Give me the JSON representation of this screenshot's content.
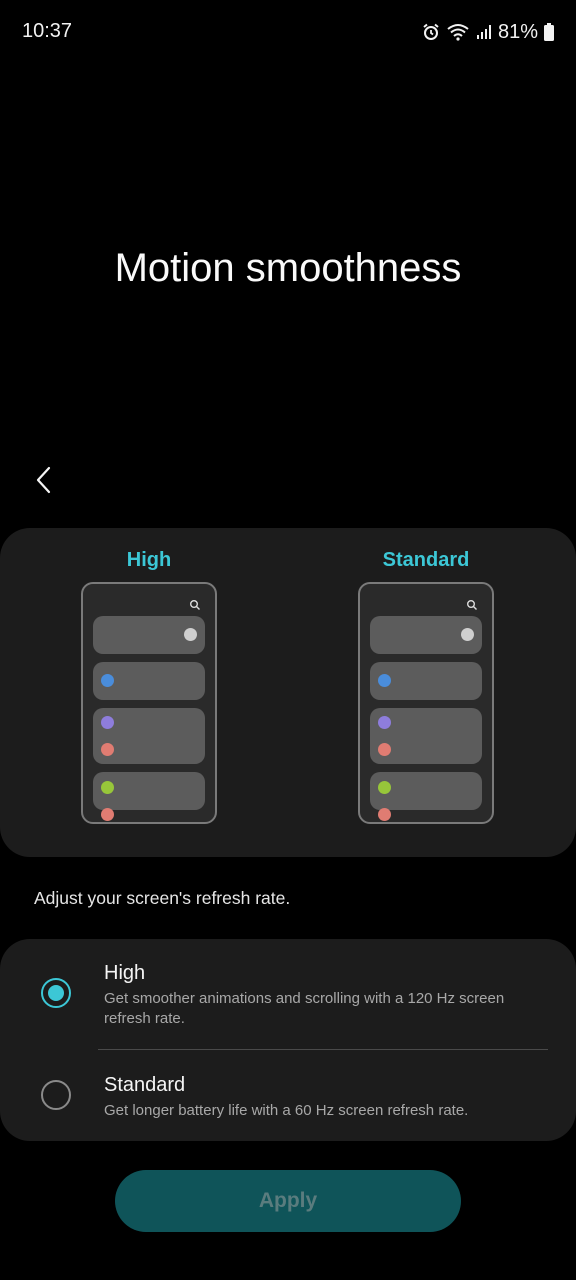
{
  "status_bar": {
    "time": "10:37",
    "battery_percent": "81%",
    "icons": [
      "alarm-icon",
      "wifi-icon",
      "signal-icon",
      "battery-icon"
    ]
  },
  "page": {
    "title": "Motion smoothness",
    "description": "Adjust your screen's refresh rate."
  },
  "preview": {
    "high_label": "High",
    "standard_label": "Standard"
  },
  "options": [
    {
      "title": "High",
      "subtitle": "Get smoother animations and scrolling with a 120 Hz screen refresh rate.",
      "selected": true
    },
    {
      "title": "Standard",
      "subtitle": "Get longer battery life with a 60 Hz screen refresh rate.",
      "selected": false
    }
  ],
  "apply_button": {
    "label": "Apply"
  },
  "colors": {
    "accent": "#3cc7d6",
    "card": "#1c1c1c",
    "apply_bg": "#0f5459"
  }
}
